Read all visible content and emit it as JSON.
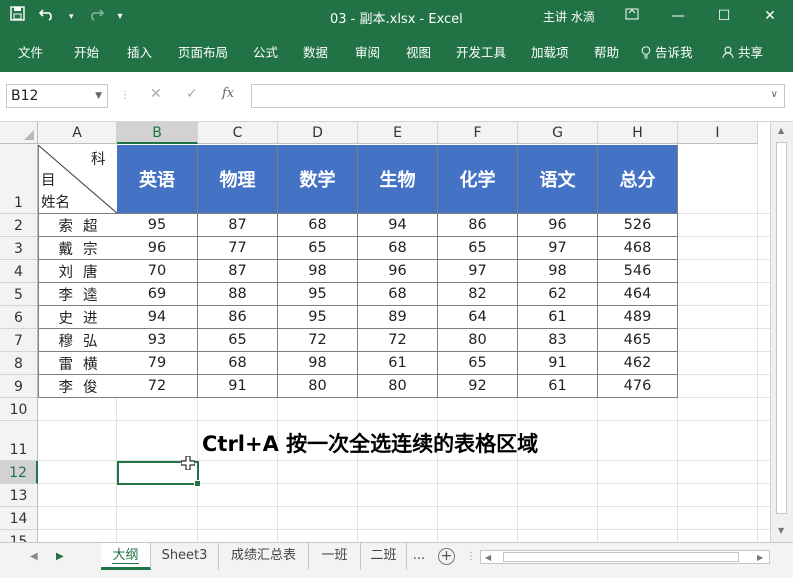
{
  "titlebar": {
    "save_icon": "save-icon",
    "undo_icon": "undo-icon",
    "redo_icon": "redo-icon",
    "qat_more": "▾",
    "document_title": "03 - 副本.xlsx - Excel",
    "user": "主讲 水滴",
    "ribbon_display_icon": "ribbon-display-icon",
    "minimize": "—",
    "maximize": "☐",
    "close": "✕"
  },
  "ribbon_tabs": [
    "文件",
    "开始",
    "插入",
    "页面布局",
    "公式",
    "数据",
    "审阅",
    "视图",
    "开发工具",
    "加载项",
    "帮助",
    "告诉我",
    "共享"
  ],
  "formula_bar": {
    "name_box": "B12",
    "cancel": "✕",
    "enter": "✓",
    "fx": "fx",
    "formula": ""
  },
  "columns": [
    "A",
    "B",
    "C",
    "D",
    "E",
    "F",
    "G",
    "H",
    "I"
  ],
  "rows": [
    "1",
    "2",
    "3",
    "4",
    "5",
    "6",
    "7",
    "8",
    "9",
    "10",
    "11",
    "12",
    "13",
    "14",
    "15"
  ],
  "header_cell": {
    "top_right": "科",
    "mid_left": "目",
    "bottom_left": "姓名"
  },
  "subjects": [
    "英语",
    "物理",
    "数学",
    "生物",
    "化学",
    "语文",
    "总分"
  ],
  "students": [
    {
      "name": "索超",
      "scores": [
        "95",
        "87",
        "68",
        "94",
        "86",
        "96",
        "526"
      ]
    },
    {
      "name": "戴宗",
      "scores": [
        "96",
        "77",
        "65",
        "68",
        "65",
        "97",
        "468"
      ]
    },
    {
      "name": "刘唐",
      "scores": [
        "70",
        "87",
        "98",
        "96",
        "97",
        "98",
        "546"
      ]
    },
    {
      "name": "李逵",
      "scores": [
        "69",
        "88",
        "95",
        "68",
        "82",
        "62",
        "464"
      ]
    },
    {
      "name": "史进",
      "scores": [
        "94",
        "86",
        "95",
        "89",
        "64",
        "61",
        "489"
      ]
    },
    {
      "name": "穆弘",
      "scores": [
        "93",
        "65",
        "72",
        "72",
        "80",
        "83",
        "465"
      ]
    },
    {
      "name": "雷横",
      "scores": [
        "79",
        "68",
        "98",
        "61",
        "65",
        "91",
        "462"
      ]
    },
    {
      "name": "李俊",
      "scores": [
        "72",
        "91",
        "80",
        "80",
        "92",
        "61",
        "476"
      ]
    }
  ],
  "caption": "Ctrl+A 按一次全选连续的表格区域",
  "sheet_tabs": [
    "大纲",
    "Sheet3",
    "成绩汇总表",
    "一班",
    "二班"
  ],
  "sheet_more": "...",
  "add_sheet": "+",
  "colors": {
    "accent": "#217346",
    "table_header": "#4472c4"
  }
}
